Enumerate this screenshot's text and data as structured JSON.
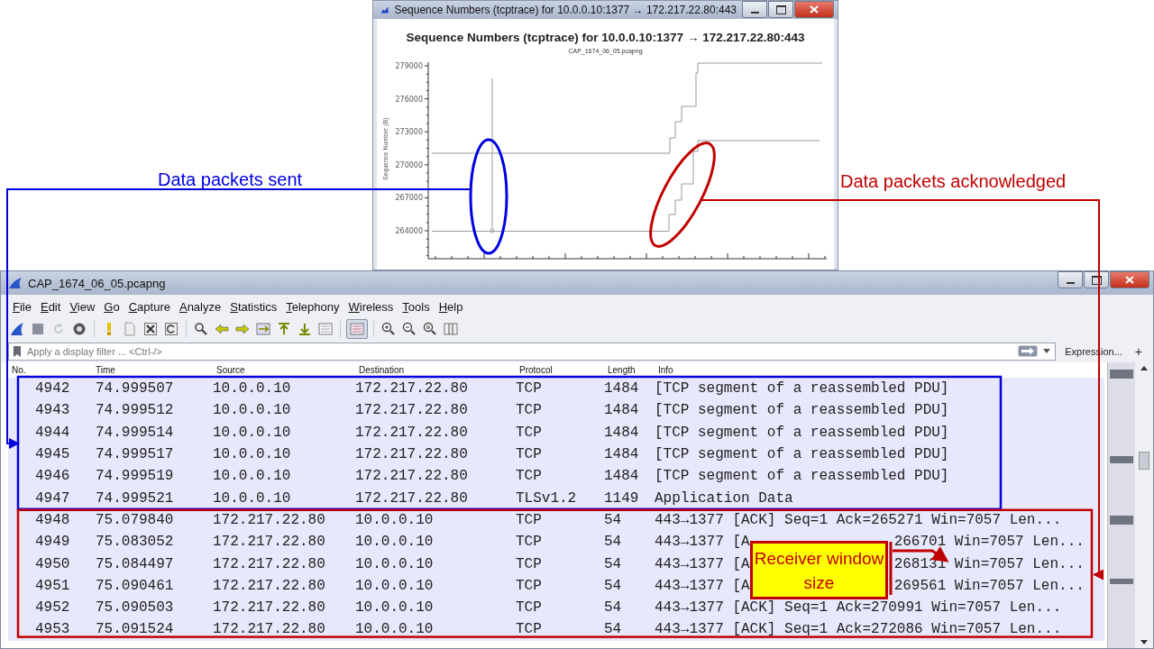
{
  "graph_window": {
    "title": "Sequence Numbers (tcptrace) for 10.0.0.10:1377 → 172.217.22.80:443",
    "chart_title": "Sequence Numbers (tcptrace) for 10.0.0.10:1377 → 172.217.22.80:443",
    "subtitle": "CAP_1674_06_05.pcapng",
    "y_axis_label": "Sequence Number (B)",
    "y_ticks": [
      "279000",
      "276000",
      "273000",
      "270000",
      "267000",
      "264000"
    ]
  },
  "annotations": [
    {
      "kind": "sent",
      "text": "Data packets sent",
      "color": "#0000e0"
    },
    {
      "kind": "acknowledged",
      "text": "Data packets acknowledged",
      "color": "#c00000"
    }
  ],
  "callout": {
    "text": "Receiver window size"
  },
  "main_window": {
    "title": "CAP_1674_06_05.pcapng",
    "menu": [
      "File",
      "Edit",
      "View",
      "Go",
      "Capture",
      "Analyze",
      "Statistics",
      "Telephony",
      "Wireless",
      "Tools",
      "Help"
    ],
    "filter": {
      "placeholder": "Apply a display filter ... <Ctrl-/>"
    },
    "expression_button": "Expression...",
    "add_button": "+"
  },
  "packet_list": {
    "columns": [
      "No.",
      "Time",
      "Source",
      "Destination",
      "Protocol",
      "Length",
      "Info"
    ],
    "rows": [
      {
        "kind": "sent",
        "no": "4942",
        "time": "74.999507",
        "source": "10.0.0.10",
        "destination": "172.217.22.80",
        "protocol": "TCP",
        "length": "1484",
        "info": [
          "[TCP segment of a reassembled PDU]"
        ]
      },
      {
        "kind": "sent",
        "no": "4943",
        "time": "74.999512",
        "source": "10.0.0.10",
        "destination": "172.217.22.80",
        "protocol": "TCP",
        "length": "1484",
        "info": [
          "[TCP segment of a reassembled PDU]"
        ]
      },
      {
        "kind": "sent",
        "no": "4944",
        "time": "74.999514",
        "source": "10.0.0.10",
        "destination": "172.217.22.80",
        "protocol": "TCP",
        "length": "1484",
        "info": [
          "[TCP segment of a reassembled PDU]"
        ]
      },
      {
        "kind": "sent",
        "no": "4945",
        "time": "74.999517",
        "source": "10.0.0.10",
        "destination": "172.217.22.80",
        "protocol": "TCP",
        "length": "1484",
        "info": [
          "[TCP segment of a reassembled PDU]"
        ]
      },
      {
        "kind": "sent",
        "no": "4946",
        "time": "74.999519",
        "source": "10.0.0.10",
        "destination": "172.217.22.80",
        "protocol": "TCP",
        "length": "1484",
        "info": [
          "[TCP segment of a reassembled PDU]"
        ]
      },
      {
        "kind": "sent",
        "no": "4947",
        "time": "74.999521",
        "source": "10.0.0.10",
        "destination": "172.217.22.80",
        "protocol": "TLSv1.2",
        "length": "1149",
        "info": [
          "Application Data"
        ]
      },
      {
        "kind": "acknowledged",
        "no": "4948",
        "time": "75.079840",
        "source": "172.217.22.80",
        "destination": "10.0.0.10",
        "protocol": "TCP",
        "length": "54",
        "info": [
          "443→1377 [ACK] Seq=1 Ack=265271 Win=7057 Len..."
        ]
      },
      {
        "kind": "acknowledged",
        "no": "4949",
        "time": "75.083052",
        "source": "172.217.22.80",
        "destination": "10.0.0.10",
        "protocol": "TCP",
        "length": "54",
        "info": [
          "443→1377 [A",
          "266701 Win=7057 Len..."
        ]
      },
      {
        "kind": "acknowledged",
        "no": "4950",
        "time": "75.084497",
        "source": "172.217.22.80",
        "destination": "10.0.0.10",
        "protocol": "TCP",
        "length": "54",
        "info": [
          "443→1377 [A",
          "268131 Win=7057 Len..."
        ]
      },
      {
        "kind": "acknowledged",
        "no": "4951",
        "time": "75.090461",
        "source": "172.217.22.80",
        "destination": "10.0.0.10",
        "protocol": "TCP",
        "length": "54",
        "info": [
          "443→1377 [A",
          "269561 Win=7057 Len..."
        ]
      },
      {
        "kind": "acknowledged",
        "no": "4952",
        "time": "75.090503",
        "source": "172.217.22.80",
        "destination": "10.0.0.10",
        "protocol": "TCP",
        "length": "54",
        "info": [
          "443→1377 [ACK] Seq=1 Ack=270991 Win=7057 Len..."
        ]
      },
      {
        "kind": "acknowledged",
        "no": "4953",
        "time": "75.091524",
        "source": "172.217.22.80",
        "destination": "10.0.0.10",
        "protocol": "TCP",
        "length": "54",
        "info": [
          "443→1377 [ACK] Seq=1 Ack=272086 Win=7057 Len..."
        ]
      }
    ]
  }
}
